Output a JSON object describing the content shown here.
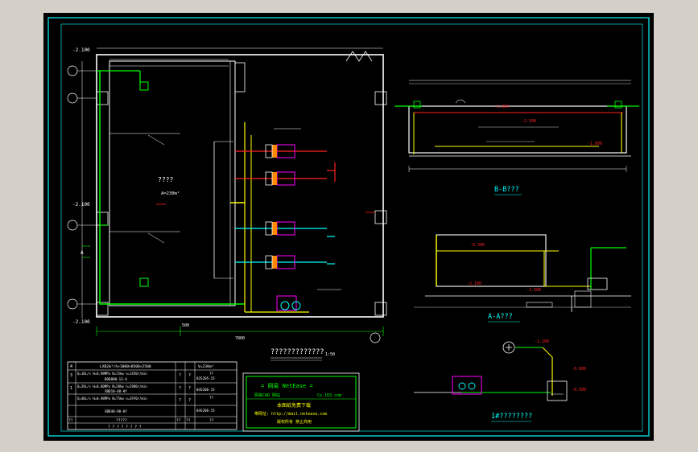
{
  "colors": {
    "background": "#000000",
    "frame": "#00c8c8",
    "wall": "#ffffff",
    "pipe_green": "#00ff00",
    "pipe_yellow": "#ffff00",
    "pipe_cyan": "#00ffff",
    "pipe_red": "#ff2020",
    "equipment_magenta": "#ff00ff",
    "window_bg": "#d4d0c8"
  },
  "plan": {
    "room_label": "????",
    "area_label": "A=230m²",
    "level_labels": [
      "-2.100",
      "-2.100",
      "-2.100"
    ],
    "grid_labels": [
      "A",
      "B"
    ],
    "dim_bottom": "7800",
    "dim_side": "500",
    "title": "?????????????",
    "title_scale": "1:50"
  },
  "section_bb": {
    "title": "B-B???",
    "levels": [
      "-1.800",
      "-2.500",
      "-1.800"
    ]
  },
  "section_aa": {
    "title": "A-A???",
    "levels": [
      "-0.300",
      "-2.100",
      "-1.500"
    ]
  },
  "detail": {
    "title": "1#????????",
    "levels": [
      "-1.200",
      "-0.800",
      "-0.500"
    ]
  },
  "equipment_table": {
    "header_no": "?",
    "header_name": "????",
    "header_qty": "?",
    "header_remark": "??",
    "rows": [
      {
        "no": "4",
        "spec": "LXB2m³/h×1000×0500×2500",
        "qty1": "",
        "qty2": "",
        "remark": "V=230m³"
      },
      {
        "no": "3",
        "spec": "Q=10L/s  H=0.98MPa  N=15kw  n=1450r/min",
        "qty1": "?",
        "qty2": "?",
        "remark": "02S205-15"
      },
      {
        "no": "2",
        "spec": "BOD800-13-4",
        "qty1": "",
        "qty2": "",
        "remark": "??"
      },
      {
        "no": "1",
        "spec": "Q=28L/s  H=0.60MPa  N=28kw  n=2980r/min",
        "qty1": "?",
        "qty2": "?",
        "remark": ""
      },
      {
        "no": "",
        "spec": "XBD10-40-HY",
        "qty1": "",
        "qty2": "",
        "remark": "04S206-15"
      },
      {
        "no": "",
        "spec": "Q=40L/s  H=0.98MPa  N=75kw  n=2970r/min",
        "qty1": "?",
        "qty2": "?",
        "remark": "??"
      },
      {
        "no": "",
        "spec": "XBD40-90-HY",
        "qty1": "",
        "qty2": "",
        "remark": "04S206-15"
      },
      {
        "no": "??",
        "spec": "?????",
        "qty1": "??",
        "qty2": "??",
        "remark": "??"
      }
    ],
    "footer": "? ? ? ? ? ? ? ?"
  },
  "title_block": {
    "brand": "= 网易 NetEase =",
    "cad_name": "网易CAD 网站",
    "site": "Co.163.com",
    "slogan": "本图纸免费下载",
    "contact": "带网址: http://mail.netease.com",
    "copyright": "版权所有 禁止商用"
  }
}
